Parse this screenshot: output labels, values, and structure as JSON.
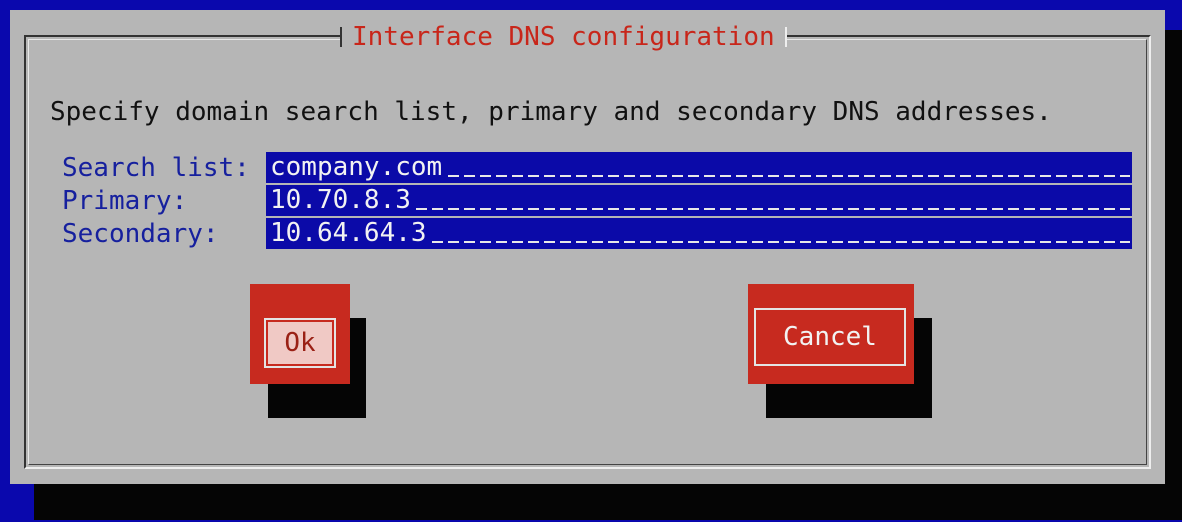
{
  "dialog": {
    "title": "Interface DNS configuration",
    "description": "Specify domain search list, primary and secondary DNS addresses.",
    "fields": [
      {
        "label": "Search list:",
        "value": "company.com"
      },
      {
        "label": "Primary:",
        "value": "10.70.8.3"
      },
      {
        "label": "Secondary:",
        "value": "10.64.64.3"
      }
    ],
    "buttons": {
      "ok": "Ok",
      "cancel": "Cancel"
    }
  },
  "colors": {
    "background": "#0a08ad",
    "dialog": "#b6b6b6",
    "title_text": "#c8261a",
    "label_text": "#16209e",
    "field_bg": "#0b0aa8",
    "button": "#c72a1f"
  }
}
